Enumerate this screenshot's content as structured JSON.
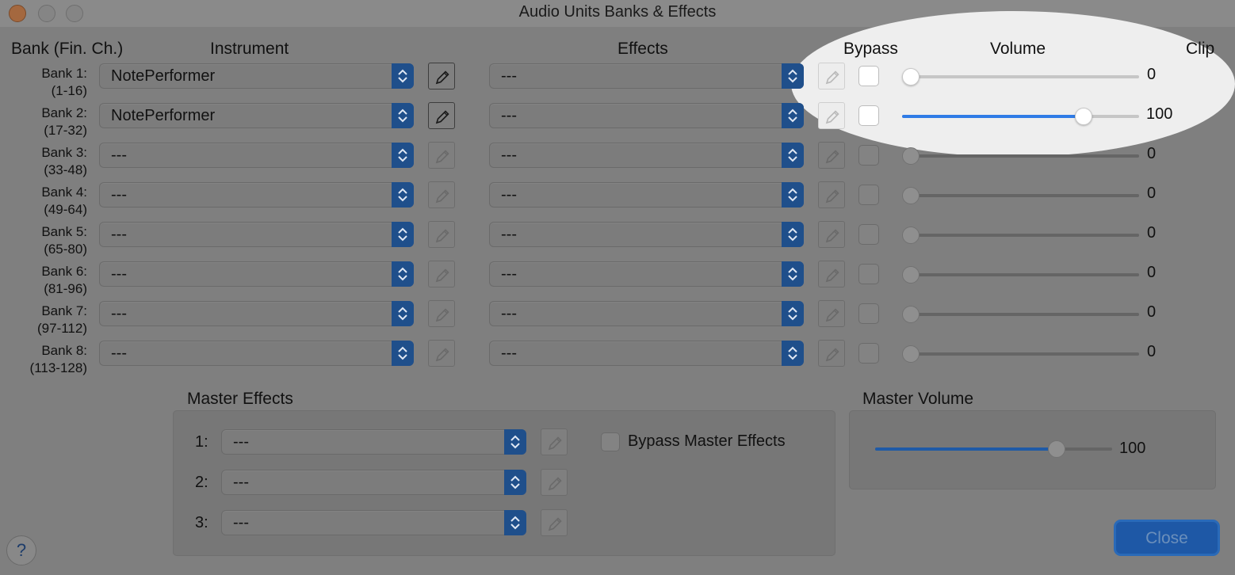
{
  "window": {
    "title": "Audio Units Banks & Effects"
  },
  "headers": {
    "bank": "Bank (Fin. Ch.)",
    "instrument": "Instrument",
    "effects": "Effects",
    "bypass": "Bypass",
    "volume": "Volume",
    "clip": "Clip"
  },
  "banks": [
    {
      "label": "Bank 1:",
      "range": "(1-16)",
      "instrument": "NotePerformer",
      "effect": "---",
      "bypass": false,
      "volume": 0,
      "volume_text": "0"
    },
    {
      "label": "Bank 2:",
      "range": "(17-32)",
      "instrument": "NotePerformer",
      "effect": "---",
      "bypass": false,
      "volume": 100,
      "volume_text": "100"
    },
    {
      "label": "Bank 3:",
      "range": "(33-48)",
      "instrument": "---",
      "effect": "---",
      "bypass": false,
      "volume": 0,
      "volume_text": "0"
    },
    {
      "label": "Bank 4:",
      "range": "(49-64)",
      "instrument": "---",
      "effect": "---",
      "bypass": false,
      "volume": 0,
      "volume_text": "0"
    },
    {
      "label": "Bank 5:",
      "range": "(65-80)",
      "instrument": "---",
      "effect": "---",
      "bypass": false,
      "volume": 0,
      "volume_text": "0"
    },
    {
      "label": "Bank 6:",
      "range": "(81-96)",
      "instrument": "---",
      "effect": "---",
      "bypass": false,
      "volume": 0,
      "volume_text": "0"
    },
    {
      "label": "Bank 7:",
      "range": "(97-112)",
      "instrument": "---",
      "effect": "---",
      "bypass": false,
      "volume": 0,
      "volume_text": "0"
    },
    {
      "label": "Bank 8:",
      "range": "(113-128)",
      "instrument": "---",
      "effect": "---",
      "bypass": false,
      "volume": 0,
      "volume_text": "0"
    }
  ],
  "master_effects": {
    "title": "Master Effects",
    "slots": [
      {
        "num": "1:",
        "value": "---"
      },
      {
        "num": "2:",
        "value": "---"
      },
      {
        "num": "3:",
        "value": "---"
      }
    ],
    "bypass_label": "Bypass Master Effects",
    "bypass": false
  },
  "master_volume": {
    "title": "Master Volume",
    "value": 100,
    "value_text": "100"
  },
  "buttons": {
    "help": "?",
    "close": "Close"
  },
  "colors": {
    "accent": "#2f7be6",
    "highlight": "#eeeeee"
  }
}
